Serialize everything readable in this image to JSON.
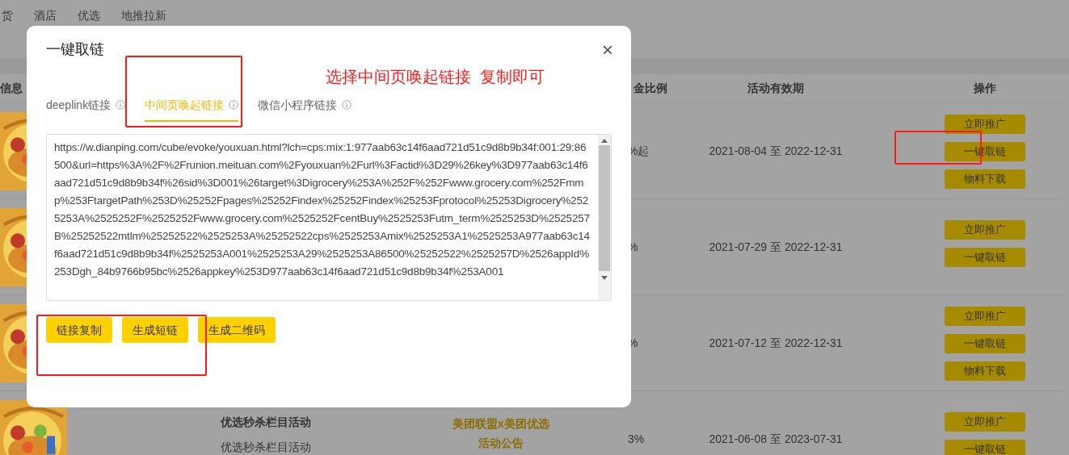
{
  "nav": [
    {
      "label": "货"
    },
    {
      "label": "酒店"
    },
    {
      "label": "优选"
    },
    {
      "label": "地推拉新"
    }
  ],
  "table": {
    "columns": [
      "信息",
      "金比例",
      "活动有效期",
      "操作"
    ],
    "rows": [
      {
        "kind": "picture",
        "commission": "%起",
        "period": "2021-08-04 至 2022-12-31",
        "actions": [
          "立即推广",
          "一键取链",
          "物料下载"
        ]
      },
      {
        "kind": "picture",
        "commission": "%",
        "period": "2021-07-29 至 2022-12-31",
        "actions": [
          "立即推广",
          "一键取链"
        ]
      },
      {
        "kind": "picture",
        "commission": "%",
        "period": "2021-07-12 至 2022-12-31",
        "actions": [
          "立即推广",
          "一键取链",
          "物料下载"
        ]
      },
      {
        "kind": "picture",
        "title": "优选秒杀栏目活动",
        "subtitle": "优选秒杀栏目活动",
        "notice": [
          "美团联盟x美团优选",
          "活动公告"
        ],
        "commission": "3%",
        "period": "2021-06-08 至 2023-07-31",
        "actions": [
          "立即推广",
          "一键取链"
        ]
      }
    ]
  },
  "dialog": {
    "title": "一键取链",
    "close": "×",
    "annotation": "选择中间页唤起链接  复制即可",
    "tabs": [
      {
        "label": "deeplink链接",
        "selected": false
      },
      {
        "label": "中间页唤起链接",
        "selected": true
      },
      {
        "label": "微信小程序链接",
        "selected": false
      }
    ],
    "link": "https://w.dianping.com/cube/evoke/youxuan.html?lch=cps:mix:1:977aab63c14f6aad721d51c9d8b9b34f:001:29:86500&url=https%3A%2F%2Frunion.meituan.com%2Fyouxuan%2Furl%3Factid%3D29%26key%3D977aab63c14f6aad721d51c9d8b9b34f%26sid%3D001%26target%3Digrocery%253A%252F%252Fwww.grocery.com%252Fmmp%253FtargetPath%253D%25252Fpages%25252Findex%25252Findex%25253Fprotocol%25253Digrocery%2525253A%2525252F%2525252Fwww.grocery.com%2525252FcentBuy%2525253Futm_term%2525253D%2525257B%25252522mtlm%25252522%2525253A%25252522cps%2525253Amix%2525253A1%2525253A977aab63c14f6aad721d51c9d8b9b34f%2525253A001%2525253A29%2525253A86500%25252522%2525257D%2526appId%253Dgh_84b9766b95bc%2526appkey%253D977aab63c14f6aad721d51c9d8b9b34f%253A001",
    "buttons": [
      "链接复制",
      "生成短链",
      "生成二维码"
    ]
  }
}
